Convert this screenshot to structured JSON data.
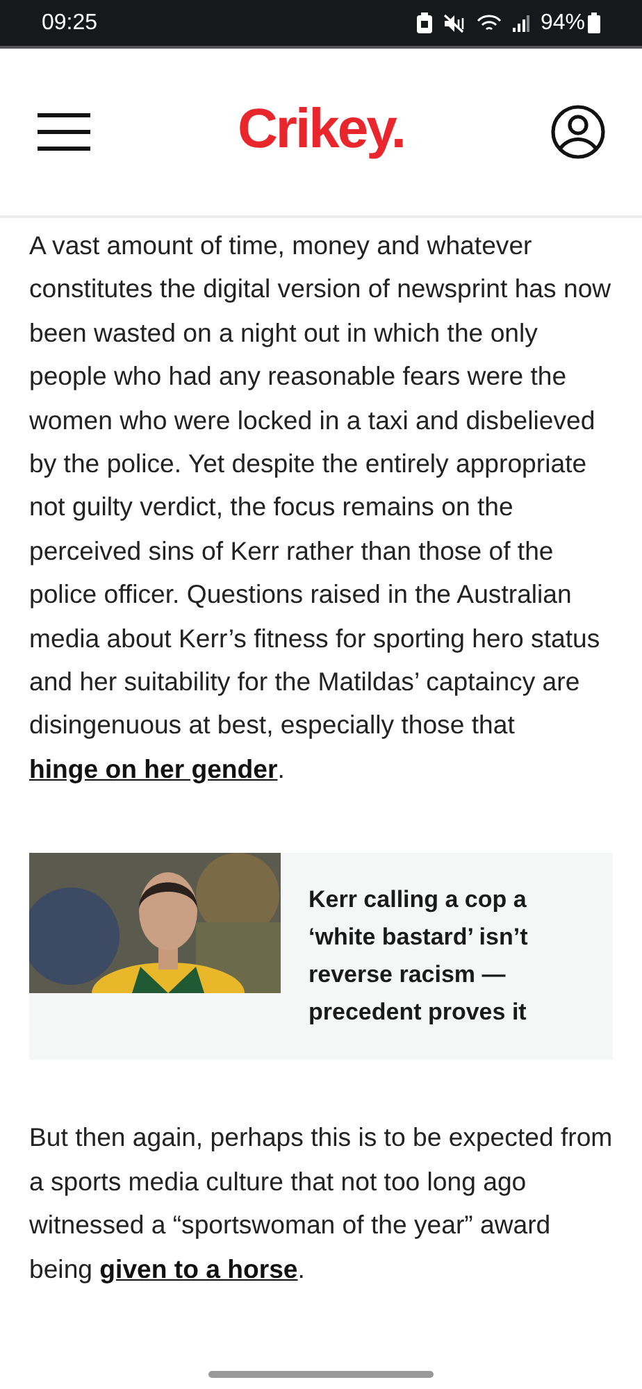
{
  "status_bar": {
    "time": "09:25",
    "battery": "94%"
  },
  "header": {
    "logo": "Crikey."
  },
  "paragraphs": [
    [
      {
        "kind": "text",
        "text": "A vast amount of time, money and whatever constitutes the digital version of newsprint has now been wasted on a night out in which the only people who had any reasonable fears were the women who were locked in a taxi and disbelieved by the police. Yet despite the entirely appropriate not guilty verdict, the focus remains on the perceived sins of Kerr rather than those of the police officer. Questions raised in the Australian media about Kerr’s fitness for sporting hero status and her suitability for the Matildas’ captaincy are disingenuous at best, especially those that "
      },
      {
        "kind": "link",
        "text": "hinge on her gender"
      },
      {
        "kind": "text",
        "text": "."
      }
    ],
    {
      "kind": "related",
      "headline": "Kerr calling a cop a ‘white bastard’ isn’t reverse racism — precedent proves it"
    },
    [
      {
        "kind": "text",
        "text": "But then again, perhaps this is to be expected from a sports media culture that not too long ago witnessed a “sportswoman of the year” award being "
      },
      {
        "kind": "link",
        "text": "given to a horse"
      },
      {
        "kind": "text",
        "text": "."
      }
    ]
  ]
}
